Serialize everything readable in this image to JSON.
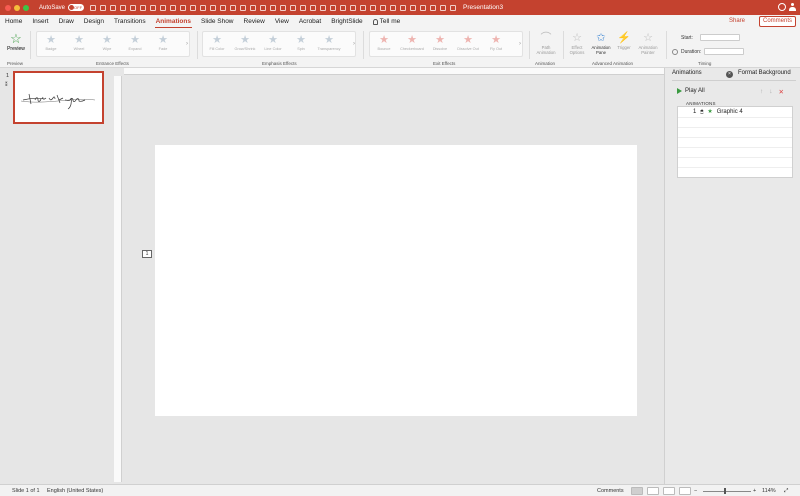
{
  "window": {
    "autosave_label": "AutoSave",
    "autosave_state": "OFF",
    "title": "Presentation3"
  },
  "tabs": [
    "Home",
    "Insert",
    "Draw",
    "Design",
    "Transitions",
    "Animations",
    "Slide Show",
    "Review",
    "View",
    "Acrobat",
    "BrightSlide"
  ],
  "active_tab": "Animations",
  "tell_me": "Tell me",
  "share_label": "Share",
  "comments_label": "Comments",
  "ribbon": {
    "preview_label": "Preview",
    "entrance_effects": [
      "Badge",
      "Wheel",
      "Wipe",
      "Expand",
      "Fade"
    ],
    "emphasis_effects": [
      "Fill Color",
      "Grow/Shrink",
      "Line Color",
      "Spin",
      "Transparency"
    ],
    "exit_effects": [
      "Bounce",
      "Checkerboard",
      "Dissolve",
      "Dissolve Out",
      "Fly Out"
    ],
    "path_animation": "Path Animation",
    "effect_options": "Effect Options",
    "animation_pane": "Animation Pane",
    "trigger": "Trigger",
    "animation_painter": "Animation Painter",
    "start_label": "Start:",
    "duration_label": "Duration:",
    "group_labels": {
      "preview": "Preview",
      "entrance": "Entrance Effects",
      "emphasis": "Emphasis Effects",
      "exit": "Exit Effects",
      "animation": "Animation",
      "advanced": "Advanced Animation",
      "timing": "Timing"
    },
    "colors": {
      "accent": "#c4422f",
      "entrance_star": "#c4cfd9",
      "exit_star": "#eeb4b0",
      "preview_star": "#3a9a40"
    }
  },
  "thumbnails": {
    "slide_number": "1"
  },
  "slide": {
    "animation_tag": "1"
  },
  "animation_pane": {
    "tab_animations": "Animations",
    "tab_format": "Format Background",
    "play_all": "Play All",
    "section_header": "ANIMATIONS",
    "items": [
      {
        "order": "1",
        "name": "Graphic 4",
        "effect_color": "#3a9a40"
      }
    ]
  },
  "status": {
    "slide_info": "Slide 1 of 1",
    "language": "English (United States)",
    "comments": "Comments",
    "zoom": "114%"
  }
}
